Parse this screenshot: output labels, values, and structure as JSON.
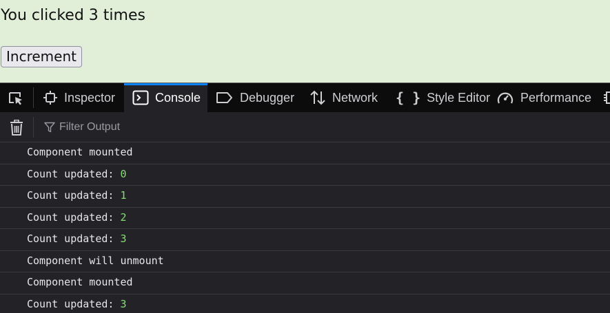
{
  "page": {
    "click_text": "You clicked 3 times",
    "increment_label": "Increment"
  },
  "devtools": {
    "tabs": [
      {
        "label": "Inspector",
        "icon": "inspector-icon",
        "active": false
      },
      {
        "label": "Console",
        "icon": "console-icon",
        "active": true
      },
      {
        "label": "Debugger",
        "icon": "debugger-icon",
        "active": false
      },
      {
        "label": "Network",
        "icon": "network-icon",
        "active": false
      },
      {
        "label": "Style Editor",
        "icon": "style-editor-icon",
        "active": false
      },
      {
        "label": "Performance",
        "icon": "performance-icon",
        "active": false
      }
    ],
    "filter_placeholder": "Filter Output",
    "accent_color": "#0a84ff",
    "number_color": "#86de74"
  },
  "console": {
    "messages": [
      {
        "text": "Component mounted",
        "value": ""
      },
      {
        "text": "Count updated: ",
        "value": "0"
      },
      {
        "text": "Count updated: ",
        "value": "1"
      },
      {
        "text": "Count updated: ",
        "value": "2"
      },
      {
        "text": "Count updated: ",
        "value": "3"
      },
      {
        "text": "Component will unmount",
        "value": ""
      },
      {
        "text": "Component mounted",
        "value": ""
      },
      {
        "text": "Count updated: ",
        "value": "3"
      }
    ]
  }
}
